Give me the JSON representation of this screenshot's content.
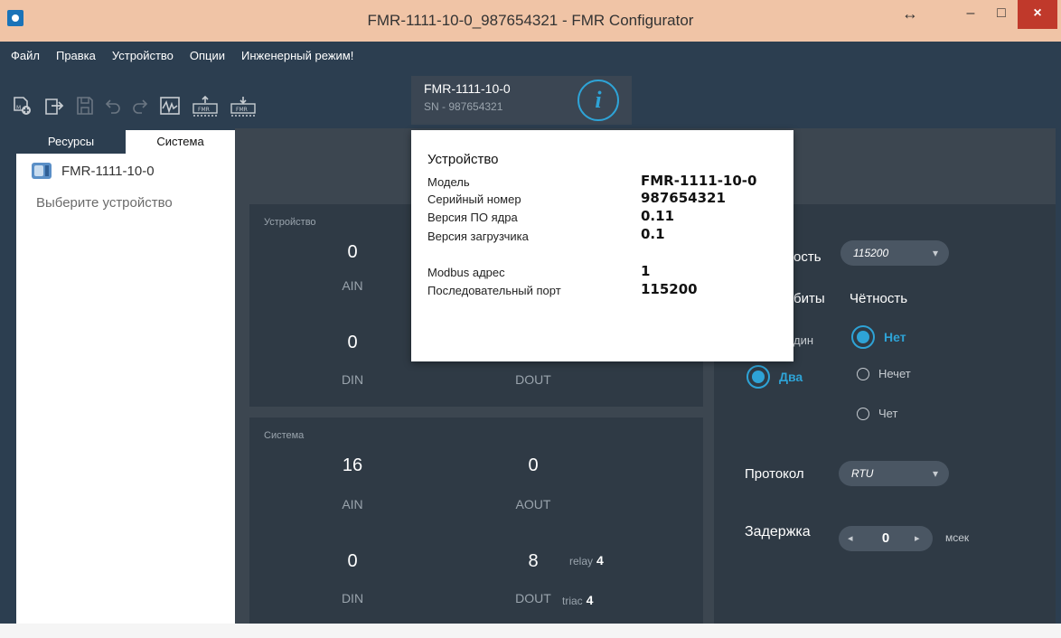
{
  "window": {
    "title": "FMR-1111-10-0_987654321 - FMR Configurator",
    "resize_glyph": "↔",
    "min_glyph": "–",
    "max_glyph": "□",
    "close_glyph": "×"
  },
  "menu": [
    "Файл",
    "Правка",
    "Устройство",
    "Опции",
    "Инженерный режим!"
  ],
  "toolbar": {
    "icons": [
      "new-project-icon",
      "export-icon",
      "save-icon",
      "undo-icon",
      "redo-icon",
      "monitor-icon",
      "upload-to-device-icon",
      "download-from-device-icon"
    ],
    "device_name": "FMR-1111-10-0",
    "device_sn": "SN - 987654321",
    "info_glyph": "i"
  },
  "sidebar": {
    "tabs": [
      "Ресурсы",
      "Система"
    ],
    "active_tab": "Система",
    "tree_item": "FMR-1111-10-0",
    "hint": "Выберите устройство"
  },
  "device_card": {
    "title": "Устройство",
    "ain_value": "0",
    "ain_label": "AIN",
    "din_value": "0",
    "din_label": "DIN",
    "dout_label": "DOUT"
  },
  "system_card": {
    "title": "Система",
    "ain_value": "16",
    "ain_label": "AIN",
    "aout_value": "0",
    "aout_label": "AOUT",
    "din_value": "0",
    "din_label": "DIN",
    "dout_value": "8",
    "dout_label": "DOUT",
    "relay_label": "relay",
    "relay_value": "4",
    "triac_label": "triac",
    "triac_value": "4"
  },
  "settings": {
    "speed_label_partial": "ость",
    "speed_value": "115200",
    "stopbits_label_partial": "биты",
    "parity_label": "Чётность",
    "stop_one_partial": "дин",
    "stop_two": "Два",
    "parity_options": [
      "Нет",
      "Нечет",
      "Чет"
    ],
    "parity_selected": "Нет",
    "protocol_label": "Протокол",
    "protocol_value": "RTU",
    "delay_label": "Задержка",
    "delay_value": "0",
    "delay_unit": "мсек",
    "accent_color": "#2ea3d6"
  },
  "popup": {
    "title": "Устройство",
    "rows": [
      {
        "label": "Модель",
        "value": "FMR-1111-10-0"
      },
      {
        "label": "Серийный номер",
        "value": "987654321"
      },
      {
        "label": "Версия ПО ядра",
        "value": "0.11"
      },
      {
        "label": "Версия загрузчика",
        "value": "0.1"
      },
      {
        "label": "Modbus адрес",
        "value": "1"
      },
      {
        "label": "Последовательный порт",
        "value": "115200"
      }
    ]
  }
}
